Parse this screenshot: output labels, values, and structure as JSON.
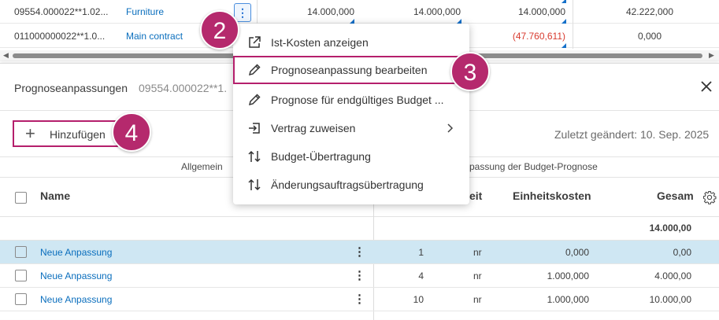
{
  "top_grid": {
    "rows": [
      {
        "code": "09554.000022**1.02...",
        "category": "Furniture",
        "v1": "14.000,000",
        "v2": "14.000,000",
        "v3": "14.000,000",
        "v4": "42.222,000"
      },
      {
        "code": "011000000022**1.0...",
        "category": "Main contract",
        "v3": "(47.760,611)",
        "v4": "0,000"
      }
    ],
    "kebab_glyph": "⋮",
    "scroll_left": "◀",
    "scroll_right": "▶"
  },
  "panel": {
    "title": "Prognoseanpassungen",
    "subtitle": "09554.000022**1.",
    "add_label": "Hinzufügen",
    "add_glyph": "+",
    "last_changed": "Zuletzt geändert: 10. Sep. 2025",
    "group_general": "Allgemein",
    "group_adjust": "passung der Budget-Prognose",
    "col_name": "Name",
    "col_unit": "eit",
    "col_unit_cost": "Einheitskosten",
    "col_total": "Gesam",
    "total_value": "14.000,00",
    "rows": [
      {
        "name": "Neue Anpassung",
        "qty": "1",
        "unit": "nr",
        "unit_cost": "0,000",
        "total": "0,00"
      },
      {
        "name": "Neue Anpassung",
        "qty": "4",
        "unit": "nr",
        "unit_cost": "1.000,000",
        "total": "4.000,00"
      },
      {
        "name": "Neue Anpassung",
        "qty": "10",
        "unit": "nr",
        "unit_cost": "1.000,000",
        "total": "10.000,00"
      }
    ]
  },
  "menu": {
    "items": [
      {
        "label": "Ist-Kosten anzeigen",
        "icon": "external-link-icon"
      },
      {
        "label": "Prognoseanpassung bearbeiten",
        "icon": "pencil-icon"
      },
      {
        "label": "Prognose für endgültiges Budget ...",
        "icon": "pencil-icon"
      },
      {
        "label": "Vertrag zuweisen",
        "icon": "assign-icon"
      },
      {
        "label": "Budget-Übertragung",
        "icon": "transfer-icon"
      },
      {
        "label": "Änderungsauftragsübertragung",
        "icon": "transfer-icon"
      }
    ]
  },
  "badges": [
    "2",
    "3",
    "4"
  ],
  "colors": {
    "accent": "#b5296d",
    "link": "#0a6ebd",
    "negative": "#d83a2e",
    "selected_row": "#cfe7f3"
  }
}
